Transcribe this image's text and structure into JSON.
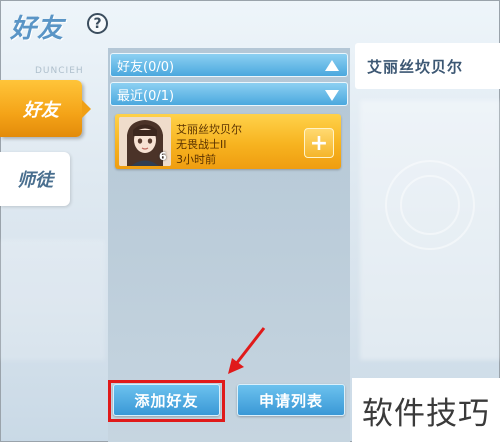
{
  "header": {
    "title": "好友",
    "help_icon_glyph": "?",
    "faded_label": "DUNCIEH"
  },
  "nav": {
    "items": [
      {
        "label": "好友",
        "active": true
      },
      {
        "label": "师徒",
        "active": false
      }
    ]
  },
  "list": {
    "sections": [
      {
        "label": "好友(0/0)",
        "toggle_icon": "triangle-up-icon"
      },
      {
        "label": "最近(0/1)",
        "toggle_icon": "triangle-down-icon"
      }
    ],
    "recent": [
      {
        "name": "艾丽丝坎贝尔",
        "title": "无畏战士II",
        "last_seen": "3小时前",
        "level": "6",
        "action_glyph": "+"
      }
    ]
  },
  "info_panel": {
    "name": "艾丽丝坎贝尔"
  },
  "buttons": {
    "add_friend": "添加好友",
    "request_list": "申请列表"
  },
  "watermark": "软件技巧",
  "colors": {
    "accent_blue": "#4aa8de",
    "active_tab_orange": "#f4a317",
    "highlight_red": "#e01a1a"
  }
}
